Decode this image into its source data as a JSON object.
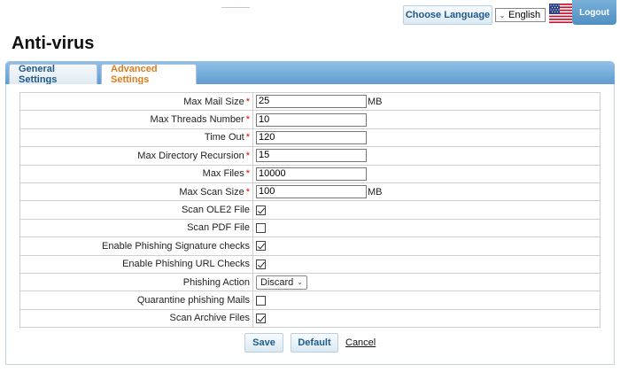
{
  "header": {
    "collapse_icon": "chevron-up-icon",
    "choose_language_label": "Choose Language",
    "language_selected": "English",
    "flag_icon": "us-flag-icon",
    "logout_label": "Logout"
  },
  "page": {
    "title": "Anti-virus"
  },
  "tabs": [
    {
      "label": "General Settings",
      "active": false
    },
    {
      "label": "Advanced Settings",
      "active": true
    }
  ],
  "form": {
    "rows": [
      {
        "label": "Max Mail Size",
        "required": "*",
        "value": "25",
        "unit": "MB"
      },
      {
        "label": "Max Threads Number",
        "required": "*",
        "value": "10"
      },
      {
        "label": "Time Out",
        "required": "*",
        "value": "120"
      },
      {
        "label": "Max Directory Recursion",
        "required": "*",
        "value": "15"
      },
      {
        "label": "Max Files",
        "required": "*",
        "value": "10000"
      },
      {
        "label": "Max Scan Size",
        "required": "*",
        "value": "100",
        "unit": "MB"
      },
      {
        "label": "Scan OLE2 File",
        "checked": true
      },
      {
        "label": "Scan PDF File",
        "checked": false
      },
      {
        "label": "Enable Phishing Signature checks",
        "checked": true
      },
      {
        "label": "Enable Phishing URL Checks",
        "checked": true
      },
      {
        "label": "Phishing Action",
        "selected": "Discard"
      },
      {
        "label": "Quarantine phishing Mails",
        "checked": false
      },
      {
        "label": "Scan Archive Files",
        "checked": true
      }
    ]
  },
  "actions": {
    "save_label": "Save",
    "default_label": "Default",
    "cancel_label": "Cancel"
  },
  "colors": {
    "tab_bar": "#5f9cd2",
    "active_tab_text": "#e07b1a",
    "required_marker": "#dd0000",
    "logout_bg": "#4f8fc1"
  }
}
